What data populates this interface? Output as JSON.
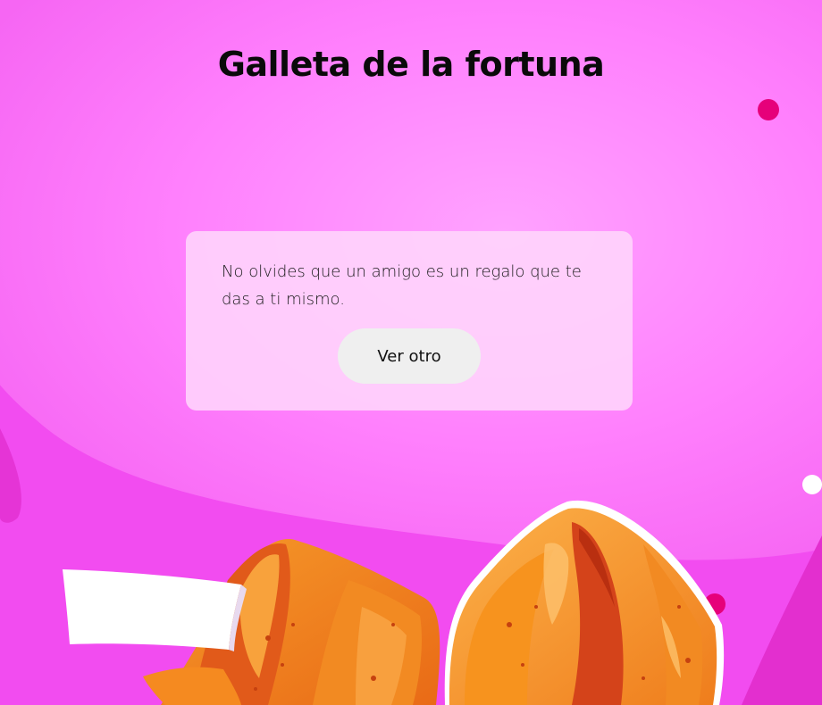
{
  "page": {
    "title": "Galleta de la fortuna"
  },
  "fortune": {
    "message": "No olvides que un amigo es un regalo que te das a ti mismo.",
    "button_label": "Ver otro"
  },
  "colors": {
    "background": "#f24cf0",
    "background_highlight": "#ff80ff",
    "card": "#ffd7fc",
    "button": "#efefef",
    "cookie": "#f7931e",
    "cookie_shadow": "#d4431a",
    "dot_accent": "#e6007a",
    "dot_light": "#ffb3f8"
  }
}
